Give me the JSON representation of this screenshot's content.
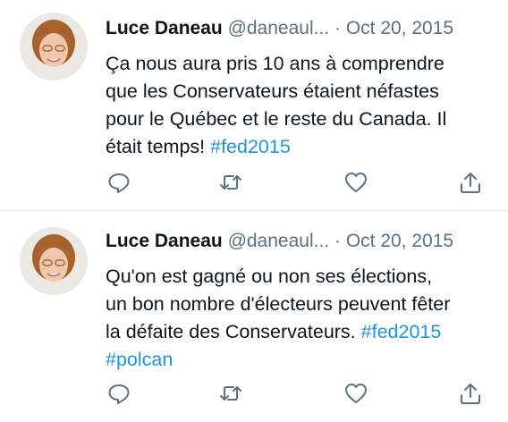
{
  "tweets": [
    {
      "author_name": "Luce Daneau",
      "author_handle": "@daneaul...",
      "separator": "·",
      "date": "Oct 20, 2015",
      "text": "Ça nous aura pris 10 ans à comprendre\nque les Conservateurs étaient néfastes\npour le Québec et le reste du Canada. Il\nétait temps! ",
      "hashtags": "#fed2015",
      "actions": [
        "reply-icon",
        "retweet-icon",
        "like-icon",
        "share-icon"
      ]
    },
    {
      "author_name": "Luce Daneau",
      "author_handle": "@daneaul...",
      "separator": "·",
      "date": "Oct 20, 2015",
      "text": "Qu'on est gagné ou non ses élections,\nun bon nombre d'électeurs peuvent fêter\nla défaite des Conservateurs.  ",
      "hashtags": "#fed2015\n#polcan",
      "actions": [
        "reply-icon",
        "retweet-icon",
        "like-icon",
        "share-icon"
      ]
    }
  ],
  "colors": {
    "text": "#0f1419",
    "secondary": "#5b7083",
    "hashtag": "#1b95e0",
    "divider": "#e6ecf0"
  }
}
